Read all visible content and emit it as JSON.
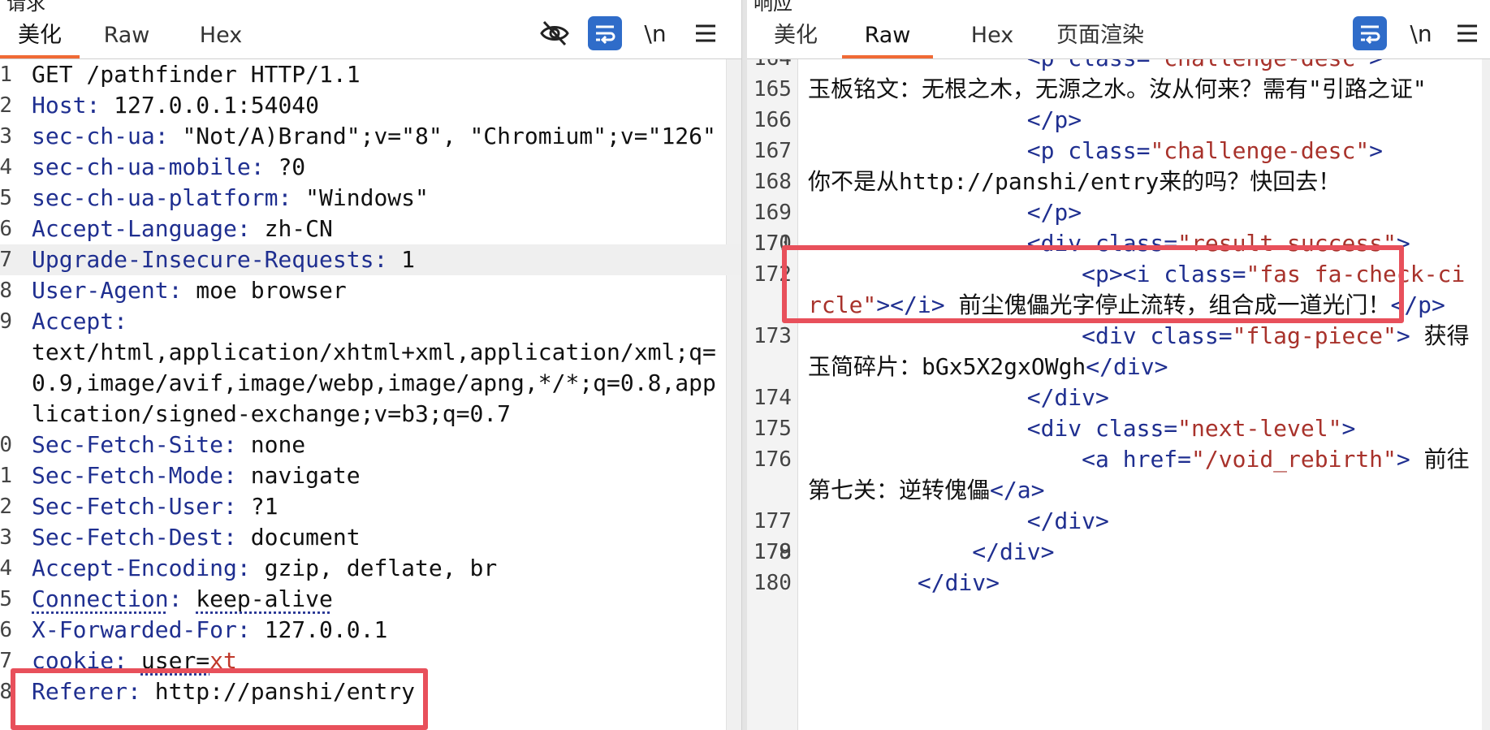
{
  "left": {
    "title": "请求",
    "tabs": [
      "美化",
      "Raw",
      "Hex"
    ],
    "active_tab": "美化",
    "toolbar": {
      "hide_icon": "eye-slash-icon",
      "wrap_icon": "wrap-lines-icon",
      "newline_label": "\\n",
      "menu_icon": "hamburger-menu-icon"
    },
    "request_line": "GET /pathfinder HTTP/1.1",
    "headers": [
      {
        "key": "Host",
        "value": "127.0.0.1:54040"
      },
      {
        "key": "sec-ch-ua",
        "value": "\"Not/A)Brand\";v=\"8\", \"Chromium\";v=\"126\""
      },
      {
        "key": "sec-ch-ua-mobile",
        "value": "?0"
      },
      {
        "key": "sec-ch-ua-platform",
        "value": "\"Windows\""
      },
      {
        "key": "Accept-Language",
        "value": "zh-CN"
      },
      {
        "key": "Upgrade-Insecure-Requests",
        "value": "1"
      },
      {
        "key": "User-Agent",
        "value": "moe browser"
      },
      {
        "key": "Accept",
        "value": "text/html,application/xhtml+xml,application/xml;q=0.9,image/avif,image/webp,image/apng,*/*;q=0.8,application/signed-exchange;v=b3;q=0.7"
      },
      {
        "key": "Sec-Fetch-Site",
        "value": "none"
      },
      {
        "key": "Sec-Fetch-Mode",
        "value": "navigate"
      },
      {
        "key": "Sec-Fetch-User",
        "value": "?1"
      },
      {
        "key": "Sec-Fetch-Dest",
        "value": "document"
      },
      {
        "key": "Accept-Encoding",
        "value": "gzip, deflate, br"
      },
      {
        "key": "Connection",
        "value": "keep-alive"
      },
      {
        "key": "X-Forwarded-For",
        "value": "127.0.0.1"
      },
      {
        "key": "cookie",
        "value": "user=xt"
      },
      {
        "key": "Referer",
        "value": "http://panshi/entry"
      }
    ],
    "line_numbers": [
      "1",
      "2",
      "3",
      "4",
      "5",
      "6",
      "7",
      "8",
      "9",
      "0",
      "1",
      "2",
      "3",
      "4",
      "5",
      "6",
      "7",
      "8"
    ]
  },
  "right": {
    "title": "响应",
    "tabs": [
      "美化",
      "Raw",
      "Hex",
      "页面渲染"
    ],
    "active_tab": "Raw",
    "toolbar": {
      "wrap_icon": "wrap-lines-icon",
      "newline_label": "\\n",
      "menu_icon": "hamburger-menu-icon"
    },
    "lines": [
      {
        "n": "164",
        "indent": "                ",
        "parts": [
          [
            "tag",
            "<"
          ],
          [
            "tag",
            "p "
          ],
          [
            "attr",
            "class="
          ],
          [
            "aval",
            "\"challenge-desc\""
          ],
          [
            "tag",
            ">"
          ]
        ]
      },
      {
        "n": "165",
        "indent": "",
        "parts": [
          [
            "txt",
            ""
          ]
        ]
      },
      {
        "n": "",
        "indent": "",
        "parts": [
          [
            "txt",
            "玉板铭文：无根之木，无源之水。汝从何来？需有\"引路之证\""
          ]
        ]
      },
      {
        "n": "166",
        "indent": "                ",
        "parts": [
          [
            "tag",
            "</p>"
          ]
        ]
      },
      {
        "n": "167",
        "indent": "                ",
        "parts": [
          [
            "tag",
            "<p "
          ],
          [
            "attr",
            "class="
          ],
          [
            "aval",
            "\"challenge-desc\""
          ],
          [
            "tag",
            ">"
          ]
        ]
      },
      {
        "n": "168",
        "indent": "",
        "parts": [
          [
            "txt",
            ""
          ]
        ]
      },
      {
        "n": "",
        "indent": "",
        "parts": [
          [
            "txt",
            "你不是从http://panshi/entry来的吗？快回去！"
          ]
        ]
      },
      {
        "n": "169",
        "indent": "                ",
        "parts": [
          [
            "tag",
            "</p>"
          ]
        ]
      },
      {
        "n": "170",
        "indent": "",
        "parts": [
          [
            "txt",
            ""
          ]
        ]
      },
      {
        "n": "171",
        "indent": "                ",
        "parts": [
          [
            "tag",
            "<div "
          ],
          [
            "attr",
            "class="
          ],
          [
            "aval",
            "\"result success\""
          ],
          [
            "tag",
            ">"
          ]
        ]
      },
      {
        "n": "172",
        "indent": "                    ",
        "parts": [
          [
            "tag",
            "<p><i "
          ],
          [
            "attr",
            "class="
          ],
          [
            "aval",
            "\"fas fa-check-circle\""
          ],
          [
            "tag",
            "></i> "
          ],
          [
            "txt",
            "前尘傀儡光字停止流转，组合成一道光门！"
          ],
          [
            "tag",
            "</p>"
          ]
        ]
      },
      {
        "n": "173",
        "indent": "                    ",
        "parts": [
          [
            "tag",
            "<div "
          ],
          [
            "attr",
            "class="
          ],
          [
            "aval",
            "\"flag-piece\""
          ],
          [
            "tag",
            ">"
          ],
          [
            "txt",
            " 获得玉简碎片：bGx5X2gxOWgh"
          ],
          [
            "tag",
            "</div>"
          ]
        ]
      },
      {
        "n": "174",
        "indent": "                ",
        "parts": [
          [
            "tag",
            "</div>"
          ]
        ]
      },
      {
        "n": "175",
        "indent": "                ",
        "parts": [
          [
            "tag",
            "<div "
          ],
          [
            "attr",
            "class="
          ],
          [
            "aval",
            "\"next-level\""
          ],
          [
            "tag",
            ">"
          ]
        ]
      },
      {
        "n": "176",
        "indent": "                    ",
        "parts": [
          [
            "tag",
            "<a "
          ],
          [
            "attr",
            "href="
          ],
          [
            "aval",
            "\"/void_rebirth\""
          ],
          [
            "tag",
            ">"
          ],
          [
            "txt",
            " 前往第七关：逆转傀儡"
          ],
          [
            "tag",
            "</a>"
          ]
        ]
      },
      {
        "n": "177",
        "indent": "                ",
        "parts": [
          [
            "tag",
            "</div>"
          ]
        ]
      },
      {
        "n": "178",
        "indent": "",
        "parts": [
          [
            "txt",
            ""
          ]
        ]
      },
      {
        "n": "179",
        "indent": "            ",
        "parts": [
          [
            "tag",
            "</div>"
          ]
        ]
      },
      {
        "n": "180",
        "indent": "        ",
        "parts": [
          [
            "tag",
            "</div>"
          ]
        ]
      }
    ]
  },
  "colors": {
    "accent_tab_underline": "#f06a35",
    "wrap_button_bg": "#2f6cc9",
    "highlight_box": "#e8505b",
    "header_key": "#1f2f90",
    "attr_value": "#a8322b"
  }
}
